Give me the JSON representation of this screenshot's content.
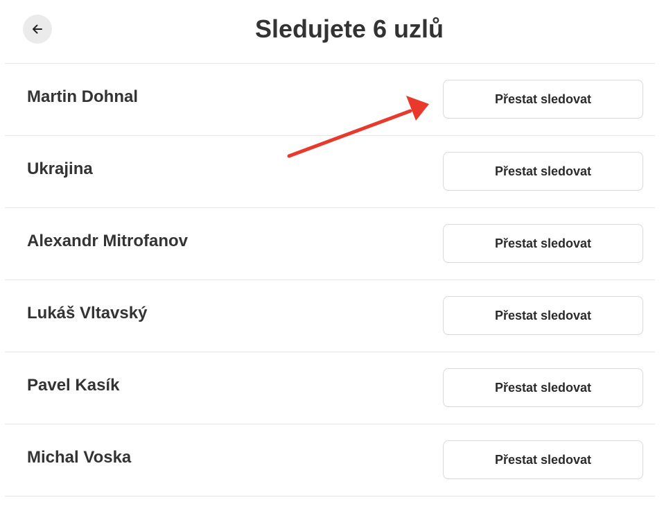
{
  "header": {
    "back_icon": "arrow-left-icon",
    "title": "Sledujete 6 uzlů"
  },
  "following": [
    {
      "name": "Martin Dohnal",
      "button_label": "Přestat sledovat"
    },
    {
      "name": "Ukrajina",
      "button_label": "Přestat sledovat"
    },
    {
      "name": "Alexandr Mitrofanov",
      "button_label": "Přestat sledovat"
    },
    {
      "name": "Lukáš Vltavský",
      "button_label": "Přestat sledovat"
    },
    {
      "name": "Pavel Kasík",
      "button_label": "Přestat sledovat"
    },
    {
      "name": "Michal Voska",
      "button_label": "Přestat sledovat"
    }
  ],
  "annotation": {
    "arrow_color": "#e8392c",
    "points_to": "first unfollow button"
  }
}
